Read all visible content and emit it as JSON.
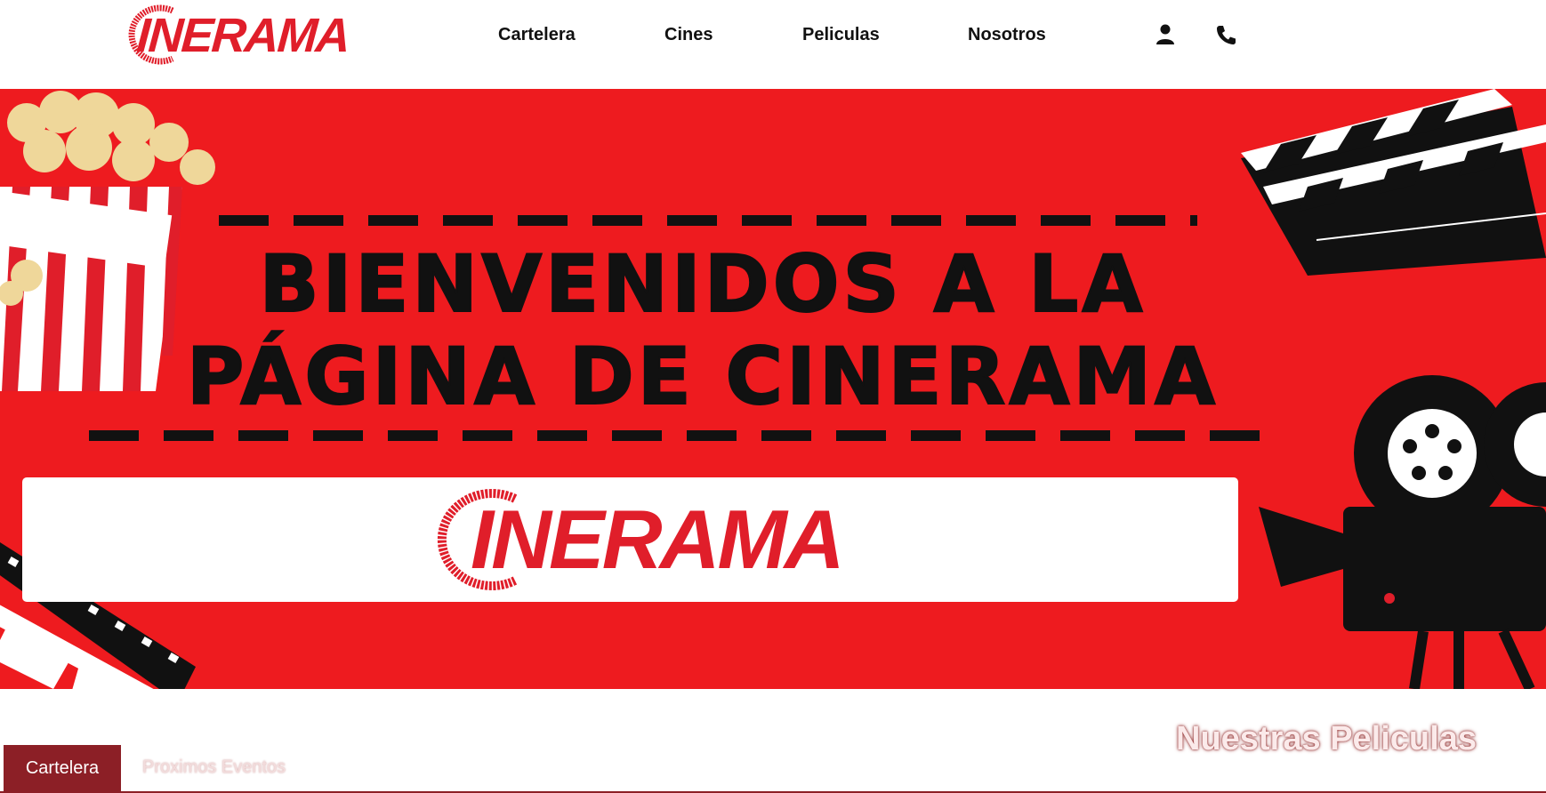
{
  "brand": {
    "logo_text": "INERAMA",
    "accent_color": "#e01e2a",
    "dark_red": "#8c1f26",
    "hero_bg": "#ee1b1f"
  },
  "nav": {
    "items": [
      {
        "label": "Cartelera"
      },
      {
        "label": "Cines"
      },
      {
        "label": "Peliculas"
      },
      {
        "label": "Nosotros"
      }
    ],
    "icons": [
      "user-icon",
      "phone-icon"
    ]
  },
  "hero": {
    "title_line1": "BIENVENIDOS A LA",
    "title_line2": "PÁGINA DE CINERAMA",
    "panel_logo_text": "INERAMA"
  },
  "tabs": {
    "active": "Cartelera",
    "inactive": "Proximos Eventos"
  },
  "section": {
    "title": "Nuestras Peliculas"
  }
}
